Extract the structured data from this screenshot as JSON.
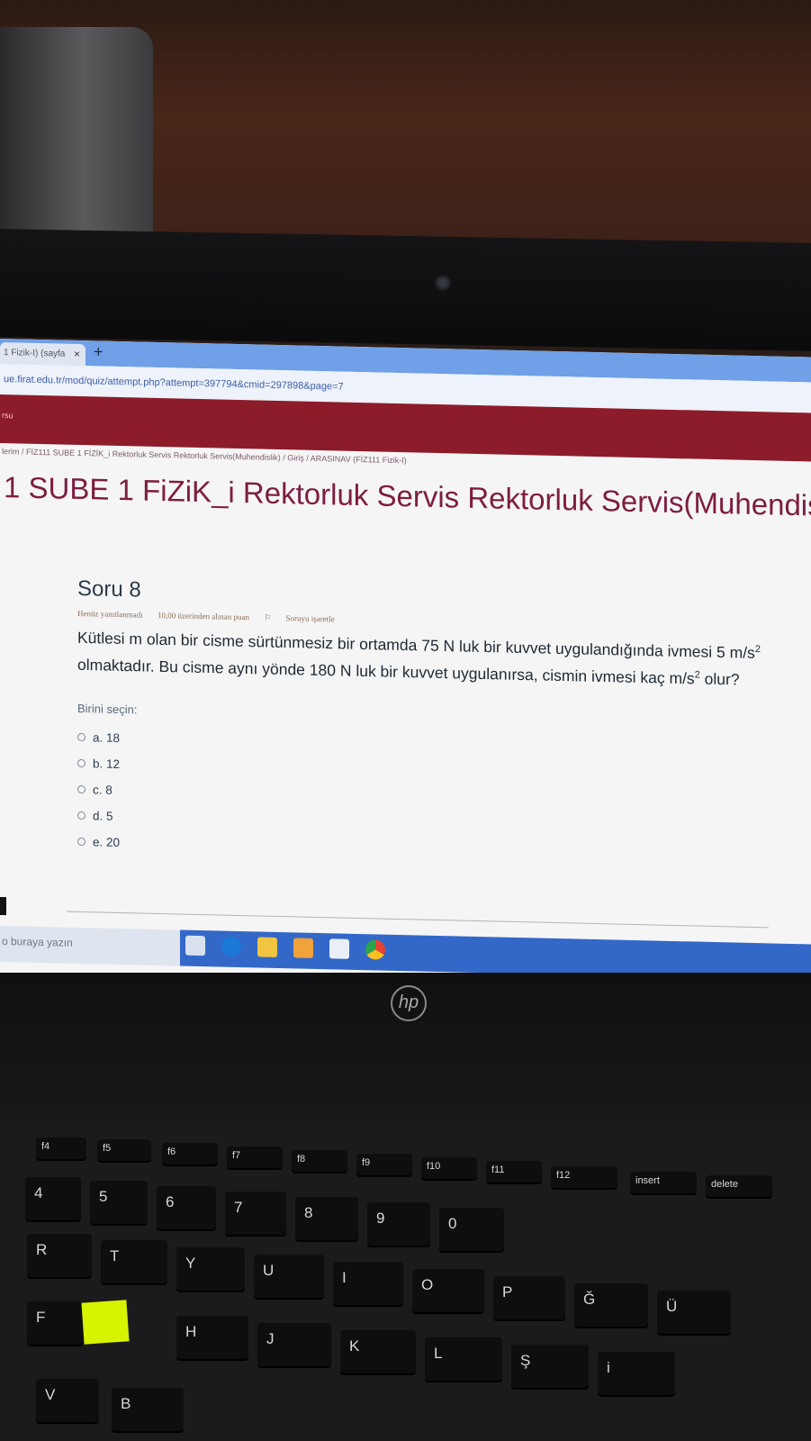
{
  "browser": {
    "tab_title": "1 Fizik-I) (sayfa",
    "tab_close": "×",
    "new_tab": "+",
    "url": "ue.firat.edu.tr/mod/quiz/attempt.php?attempt=397794&cmid=297898&page=7"
  },
  "site_header": {
    "text": "rsu"
  },
  "breadcrumb": "lerim  /  FİZ111 SUBE 1 FİZİK_i Rektorluk Servis Rektorluk Servis(Muhendislik)  /  Giriş  /  ARASINAV (FİZ111 Fizik-I)",
  "course_title": "1 SUBE 1 FiZiK_i Rektorluk Servis Rektorluk Servis(Muhendis",
  "question": {
    "heading": "Soru 8",
    "status": "Henüz yanıtlanmadı",
    "points": "10,00 üzerinden alınan puan",
    "flag": "Soruyu işaretle",
    "text_part1": "Kütlesi m olan bir cisme sürtünmesiz bir ortamda 75 N luk bir kuvvet uygulandığında ivmesi 5 m/s",
    "text_part2": " olmaktadır. Bu cisme aynı yönde 180 N luk bir kuvvet uygulanırsa, cismin ivmesi kaç m/s",
    "text_part3": " olur?",
    "superscript": "2",
    "choose_label": "Birini seçin:",
    "answers": [
      "a. 18",
      "b. 12",
      "c. 8",
      "d. 5",
      "e. 20"
    ]
  },
  "taskbar": {
    "search_placeholder": "o buraya yazın"
  },
  "laptop": {
    "brand": "hp",
    "function_keys": [
      "f4",
      "f5",
      "f6",
      "f7",
      "f8",
      "f9",
      "f10",
      "f11",
      "f12",
      "insert",
      "delete"
    ],
    "number_keys": [
      "4",
      "5",
      "6",
      "7",
      "8",
      "9",
      "0"
    ],
    "letter_keys_row1": [
      "R",
      "T",
      "Y",
      "U",
      "I",
      "O",
      "P",
      "Ğ",
      "Ü"
    ],
    "letter_keys_row2": [
      "F",
      "H",
      "J",
      "K",
      "L",
      "Ş",
      "i"
    ],
    "letter_keys_row3": [
      "V",
      "B"
    ]
  },
  "colors": {
    "site_header": "#8d1c2b",
    "course_title": "#7d1d3f",
    "taskbar": "#3368c8",
    "sticky_note": "#d6f300"
  }
}
